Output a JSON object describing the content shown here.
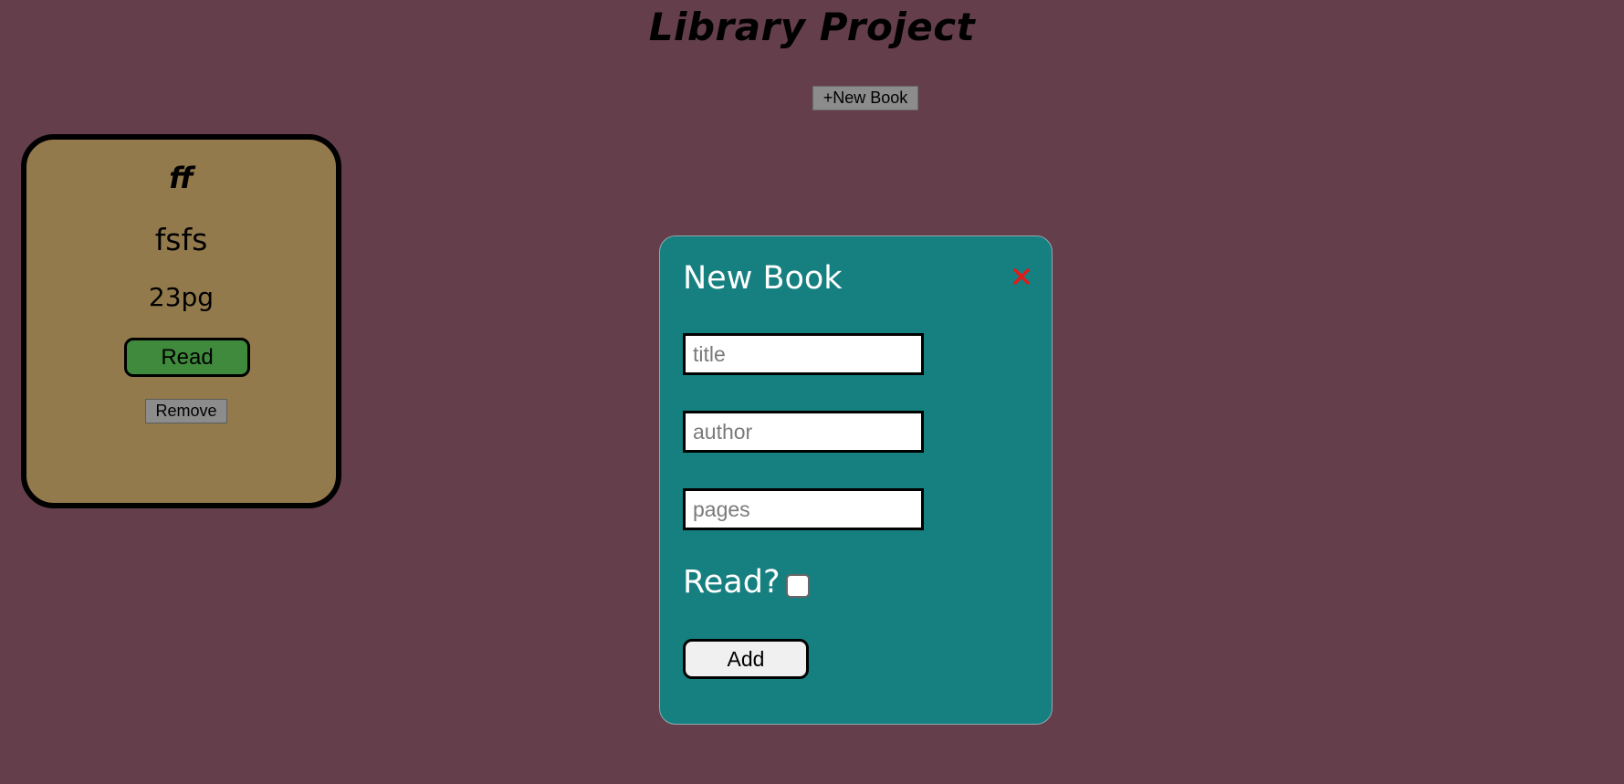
{
  "header": {
    "title": "Library Project",
    "new_book_label": "+New Book"
  },
  "books": [
    {
      "title": "ff",
      "author": "fsfs",
      "pages": "23pg",
      "read_label": "Read",
      "remove_label": "Remove"
    }
  ],
  "modal": {
    "title": "New Book",
    "close_symbol": "✕",
    "title_placeholder": "title",
    "author_placeholder": "author",
    "pages_placeholder": "pages",
    "read_label": "Read?",
    "read_checked": false,
    "add_label": "Add"
  },
  "colors": {
    "background": "#643f4b",
    "card": "#937a4c",
    "read_button": "#3f8a3c",
    "modal": "#167f80",
    "close_icon": "#e01b1b"
  }
}
